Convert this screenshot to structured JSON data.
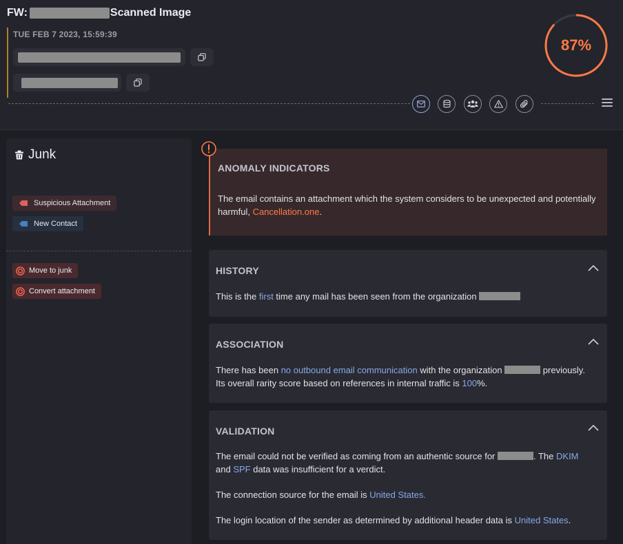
{
  "header": {
    "title_prefix": "FW:",
    "title_suffix": "Scanned Image",
    "timestamp": "TUE FEB 7 2023, 15:59:39",
    "score": 87,
    "score_label": "87%",
    "icons": [
      "mail-icon",
      "database-icon",
      "people-icon",
      "warning-icon",
      "paperclip-icon"
    ],
    "menu_icon": "hamburger-menu-icon"
  },
  "sidebar": {
    "verdict": "Junk",
    "tags": [
      {
        "label": "Suspicious Attachment",
        "color": "#e06060"
      },
      {
        "label": "New Contact",
        "color": "#4a7fc0"
      }
    ],
    "actions": [
      {
        "label": "Move to junk"
      },
      {
        "label": "Convert attachment"
      }
    ]
  },
  "anomaly": {
    "title": "ANOMALY INDICATORS",
    "text_before": "The email contains an attachment which the system considers to be unexpected and potentially harmful, ",
    "attachment": "Cancellation.one",
    "text_after": "."
  },
  "history": {
    "title": "HISTORY",
    "t1": "This is the ",
    "h1": "first",
    "t2": " time any mail has been seen from the organization "
  },
  "association": {
    "title": "ASSOCIATION",
    "t1": "There has been ",
    "h1": "no outbound email communication",
    "t2": " with the organization ",
    "t3": " previously.",
    "t4": "Its overall rarity score based on references in internal traffic is ",
    "h2": "100",
    "t5": "%."
  },
  "validation": {
    "title": "VALIDATION",
    "p1_t1": "The email could not be verified as coming from an authentic source for ",
    "p1_t2": ". The ",
    "p1_h1": "DKIM",
    "p1_t3": "and ",
    "p1_h2": "SPF",
    "p1_t4": " data was insufficient for a verdict.",
    "p2_t1": "The connection source for the email is ",
    "p2_h1": "United States",
    "p2_t2": ".",
    "p3_t1": "The login location of the sender as determined by additional header data is ",
    "p3_h1": "United States",
    "p3_t2": "."
  },
  "colors": {
    "accent_orange": "#ff7a45",
    "link_blue": "#86a9e4",
    "date_bar": "#b0812c"
  }
}
